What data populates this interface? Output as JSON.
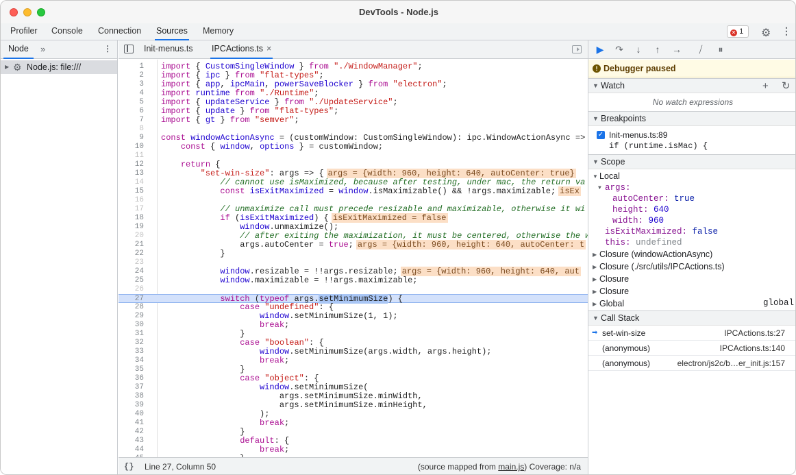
{
  "window": {
    "title": "DevTools - Node.js"
  },
  "main_tabs": [
    {
      "label": "Profiler"
    },
    {
      "label": "Console"
    },
    {
      "label": "Connection"
    },
    {
      "label": "Sources"
    },
    {
      "label": "Memory"
    }
  ],
  "error_badge": {
    "count": "1"
  },
  "navigator": {
    "tab": "Node",
    "more": "»",
    "tree": [
      {
        "label": "Node.js: file:///"
      }
    ]
  },
  "editor": {
    "tabs": [
      {
        "label": "Init-menus.ts"
      },
      {
        "label": "IPCActions.ts",
        "close": "×"
      }
    ],
    "current_line": 27,
    "lines": [
      {
        "n": "1",
        "html": "<span class='k'>import</span> { <span class='v'>CustomSingleWindow</span> } <span class='k'>from</span> <span class='s'>\"./WindowManager\"</span>;"
      },
      {
        "n": "2",
        "html": "<span class='k'>import</span> { <span class='v'>ipc</span> } <span class='k'>from</span> <span class='s'>\"flat-types\"</span>;"
      },
      {
        "n": "3",
        "html": "<span class='k'>import</span> { <span class='v'>app</span>, <span class='v'>ipcMain</span>, <span class='v'>powerSaveBlocker</span> } <span class='k'>from</span> <span class='s'>\"electron\"</span>;"
      },
      {
        "n": "4",
        "html": "<span class='k'>import</span> <span class='v'>runtime</span> <span class='k'>from</span> <span class='s'>\"./Runtime\"</span>;"
      },
      {
        "n": "5",
        "html": "<span class='k'>import</span> { <span class='v'>updateService</span> } <span class='k'>from</span> <span class='s'>\"./UpdateService\"</span>;"
      },
      {
        "n": "6",
        "html": "<span class='k'>import</span> { <span class='v'>update</span> } <span class='k'>from</span> <span class='s'>\"flat-types\"</span>;"
      },
      {
        "n": "7",
        "html": "<span class='k'>import</span> { <span class='v'>gt</span> } <span class='k'>from</span> <span class='s'>\"semver\"</span>;"
      },
      {
        "n": "8",
        "html": ""
      },
      {
        "n": "9",
        "html": "<span class='k'>const</span> <span class='v'>windowActionAsync</span> = (customWindow: CustomSingleWindow): ipc.WindowActionAsync =>"
      },
      {
        "n": "10",
        "html": "    <span class='k'>const</span> { <span class='v'>window</span>, <span class='v'>options</span> } = customWindow;"
      },
      {
        "n": "11",
        "html": ""
      },
      {
        "n": "12",
        "html": "    <span class='k'>return</span> {"
      },
      {
        "n": "13",
        "html": "        <span class='s'>\"set-win-size\"</span>: args => {<span class='inline'>args = {width: 960, height: 640, autoCenter: true}</span>"
      },
      {
        "n": "14",
        "html": "            <span class='c'>// cannot use isMaximized, because after testing, under mac, the return va</span>"
      },
      {
        "n": "15",
        "html": "            <span class='k'>const</span> <span class='v'>isExitMaximized</span> = <span class='v'>window</span>.isMaximizable() &amp;&amp; !args.maximizable;<span class='inline'>isEx</span>"
      },
      {
        "n": "16",
        "html": ""
      },
      {
        "n": "17",
        "html": "            <span class='c'>// unmaximize call must precede resizable and maximizable, otherwise it wi</span>"
      },
      {
        "n": "18",
        "html": "            <span class='k'>if</span> (<span class='v'>isExitMaximized</span>) {<span class='inline'>isExitMaximized = false</span>"
      },
      {
        "n": "19",
        "html": "                <span class='v'>window</span>.unmaximize();"
      },
      {
        "n": "20",
        "html": "                <span class='c'>// after exiting the maximization, it must be centered, otherwise the w</span>"
      },
      {
        "n": "21",
        "html": "                args.autoCenter = <span class='k'>true</span>;<span class='inline'>args = {width: 960, height: 640, autoCenter: t</span>"
      },
      {
        "n": "22",
        "html": "            }"
      },
      {
        "n": "23",
        "html": ""
      },
      {
        "n": "24",
        "html": "            <span class='v'>window</span>.resizable = !!args.resizable;<span class='inline'>args = {width: 960, height: 640, aut</span>"
      },
      {
        "n": "25",
        "html": "            <span class='v'>window</span>.maximizable = !!args.maximizable;"
      },
      {
        "n": "26",
        "html": ""
      },
      {
        "n": "27",
        "html": "            <span class='k'>switch</span> (<span class='k'>typeof</span> args.<span class='sel'>setMinimumSize</span>) {"
      },
      {
        "n": "28",
        "html": "                <span class='k'>case</span> <span class='s'>\"undefined\"</span>: {"
      },
      {
        "n": "29",
        "html": "                    <span class='v'>window</span>.setMinimumSize(1, 1);"
      },
      {
        "n": "30",
        "html": "                    <span class='k'>break</span>;"
      },
      {
        "n": "31",
        "html": "                }"
      },
      {
        "n": "32",
        "html": "                <span class='k'>case</span> <span class='s'>\"boolean\"</span>: {"
      },
      {
        "n": "33",
        "html": "                    <span class='v'>window</span>.setMinimumSize(args.width, args.height);"
      },
      {
        "n": "34",
        "html": "                    <span class='k'>break</span>;"
      },
      {
        "n": "35",
        "html": "                }"
      },
      {
        "n": "36",
        "html": "                <span class='k'>case</span> <span class='s'>\"object\"</span>: {"
      },
      {
        "n": "37",
        "html": "                    <span class='v'>window</span>.setMinimumSize("
      },
      {
        "n": "38",
        "html": "                        args.setMinimumSize.minWidth,"
      },
      {
        "n": "39",
        "html": "                        args.setMinimumSize.minHeight,"
      },
      {
        "n": "40",
        "html": "                    );"
      },
      {
        "n": "41",
        "html": "                    <span class='k'>break</span>;"
      },
      {
        "n": "42",
        "html": "                }"
      },
      {
        "n": "43",
        "html": "                <span class='k'>default</span>: {"
      },
      {
        "n": "44",
        "html": "                    <span class='k'>break</span>;"
      },
      {
        "n": "45",
        "html": "                }"
      }
    ],
    "faint_lines": [
      "8",
      "11",
      "14",
      "16",
      "17",
      "20",
      "23",
      "26"
    ]
  },
  "statusbar": {
    "braces": "{}",
    "position": "Line 27, Column 50",
    "source_prefix": "(source mapped from ",
    "source_link": "main.js",
    "source_suffix": ") Coverage: n/a"
  },
  "debugger": {
    "paused": "Debugger paused",
    "watch": {
      "title": "Watch",
      "empty": "No watch expressions"
    },
    "breakpoints": {
      "title": "Breakpoints",
      "items": [
        {
          "file": "Init-menus.ts:89",
          "code": "if (runtime.isMac) {"
        }
      ]
    },
    "scope": {
      "title": "Scope",
      "local": "Local",
      "args_key": "args:",
      "autoCenter_key": "autoCenter:",
      "autoCenter_val": "true",
      "height_key": "height:",
      "height_val": "640",
      "width_key": "width:",
      "width_val": "960",
      "isExitMaximized_key": "isExitMaximized:",
      "isExitMaximized_val": "false",
      "this_key": "this:",
      "this_val": "undefined",
      "closures": [
        "Closure (windowActionAsync)",
        "Closure (./src/utils/IPCActions.ts)",
        "Closure",
        "Closure"
      ],
      "global": "Global",
      "global_val": "global"
    },
    "call_stack": {
      "title": "Call Stack",
      "frames": [
        {
          "fn": "set-win-size",
          "loc": "IPCActions.ts:27"
        },
        {
          "fn": "(anonymous)",
          "loc": "IPCActions.ts:140"
        },
        {
          "fn": "(anonymous)",
          "loc": "electron/js2c/b…er_init.js:157"
        }
      ]
    }
  },
  "colors": {
    "accent": "#1a73e8",
    "current_line": "#d3e1fb",
    "inline_value": "#fcdfc6",
    "paused_banner": "#fffbe5"
  }
}
